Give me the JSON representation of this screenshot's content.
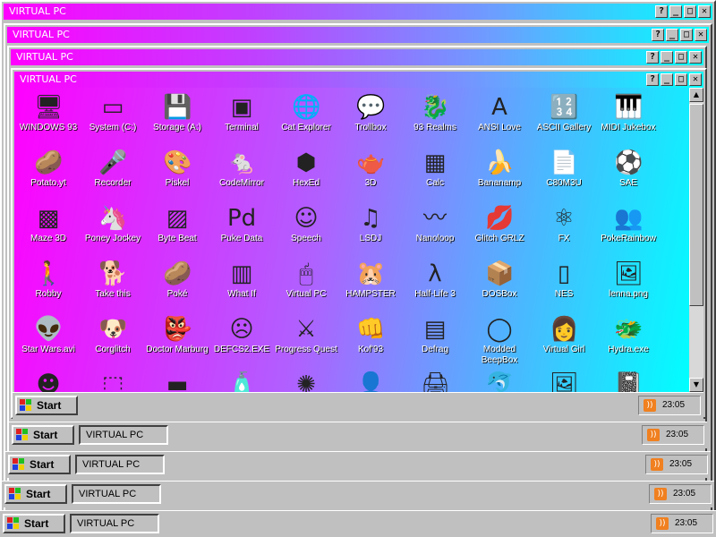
{
  "window_title": "VIRTUAL PC",
  "window_buttons": {
    "help": "?",
    "minimize": "_",
    "maximize": "□",
    "close": "✕"
  },
  "taskbar": {
    "start_label": "Start",
    "task_label": "VIRTUAL PC",
    "clock": "23:05"
  },
  "icons": [
    {
      "label": "WINDOWS 93",
      "glyph": "🖥"
    },
    {
      "label": "System (C:)",
      "glyph": "▭"
    },
    {
      "label": "Storage (A:)",
      "glyph": "💾"
    },
    {
      "label": "Terminal",
      "glyph": "▣"
    },
    {
      "label": "Cat Explorer",
      "glyph": "🌐"
    },
    {
      "label": "Trollbox",
      "glyph": "💬"
    },
    {
      "label": "93 Realms",
      "glyph": "🐉"
    },
    {
      "label": "ANSI Love",
      "glyph": "A"
    },
    {
      "label": "ASCII Gallery",
      "glyph": "🔢"
    },
    {
      "label": "MIDI Jukebox",
      "glyph": "🎹"
    },
    {
      "label": "Potato.yt",
      "glyph": "🥔"
    },
    {
      "label": "Recorder",
      "glyph": "🎤"
    },
    {
      "label": "Piskel",
      "glyph": "🎨"
    },
    {
      "label": "CodeMirror",
      "glyph": "🐁"
    },
    {
      "label": "HexEd",
      "glyph": "⬢"
    },
    {
      "label": "3D",
      "glyph": "🫖"
    },
    {
      "label": "Calc",
      "glyph": "▦"
    },
    {
      "label": "Bananamp",
      "glyph": "🍌"
    },
    {
      "label": "C80M3U",
      "glyph": "📄"
    },
    {
      "label": "SAE",
      "glyph": "⚽"
    },
    {
      "label": "Maze 3D",
      "glyph": "▩"
    },
    {
      "label": "Poney Jockey",
      "glyph": "🦄"
    },
    {
      "label": "Byte Beat",
      "glyph": "▨"
    },
    {
      "label": "Puke Data",
      "glyph": "Pd"
    },
    {
      "label": "Speech",
      "glyph": "☺"
    },
    {
      "label": "LSDJ",
      "glyph": "♫"
    },
    {
      "label": "Nanoloop",
      "glyph": "〰"
    },
    {
      "label": "Glitch GRLZ",
      "glyph": "💋"
    },
    {
      "label": "FX",
      "glyph": "⚛"
    },
    {
      "label": "PokeRainbow",
      "glyph": "👥"
    },
    {
      "label": "Robby",
      "glyph": "🚶"
    },
    {
      "label": "Take this",
      "glyph": "🐕"
    },
    {
      "label": "Poké",
      "glyph": "🥔"
    },
    {
      "label": "What If",
      "glyph": "▥"
    },
    {
      "label": "Virtual PC",
      "glyph": "🖱"
    },
    {
      "label": "HAMPSTER",
      "glyph": "🐹"
    },
    {
      "label": "Half-Life 3",
      "glyph": "λ"
    },
    {
      "label": "DOSBox",
      "glyph": "📦"
    },
    {
      "label": "NES",
      "glyph": "▯"
    },
    {
      "label": "lenna.png",
      "glyph": "🖼"
    },
    {
      "label": "Star Wars.avi",
      "glyph": "👽"
    },
    {
      "label": "Corglitch",
      "glyph": "🐶"
    },
    {
      "label": "Doctor Marburg",
      "glyph": "👺"
    },
    {
      "label": "DEFCS2.EXE",
      "glyph": "☹"
    },
    {
      "label": "Progress Quest",
      "glyph": "⚔"
    },
    {
      "label": "Kof'93",
      "glyph": "👊"
    },
    {
      "label": "Defrag",
      "glyph": "▤"
    },
    {
      "label": "Modded BeepBox",
      "glyph": "◯"
    },
    {
      "label": "Virtual Girl",
      "glyph": "👩"
    },
    {
      "label": "Hydra.exe",
      "glyph": "🐲"
    },
    {
      "label": "",
      "glyph": "☻"
    },
    {
      "label": "",
      "glyph": "⬚"
    },
    {
      "label": "",
      "glyph": "▬"
    },
    {
      "label": "",
      "glyph": "🧴"
    },
    {
      "label": "",
      "glyph": "✺"
    },
    {
      "label": "",
      "glyph": "👤"
    },
    {
      "label": "",
      "glyph": "🖨"
    },
    {
      "label": "",
      "glyph": "🐬"
    },
    {
      "label": "",
      "glyph": "🖼"
    },
    {
      "label": "",
      "glyph": "📓"
    }
  ],
  "overlay_text": "Poké"
}
